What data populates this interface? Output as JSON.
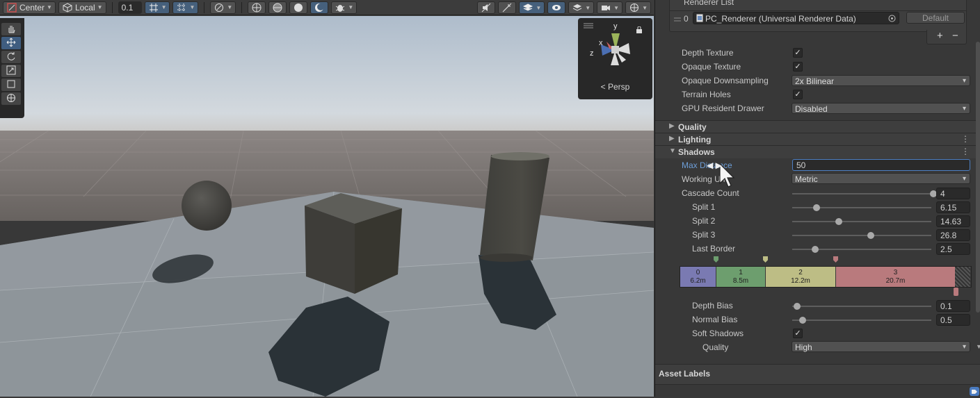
{
  "toolbar": {
    "pivot_mode": "Center",
    "pivot_rotation": "Local",
    "snap_increment": "0.1"
  },
  "scene": {
    "camera_projection": "Persp",
    "gizmo_axes": [
      "y",
      "x",
      "z"
    ],
    "tools": [
      "hand-tool",
      "move-tool",
      "rotate-tool",
      "scale-tool",
      "rect-tool",
      "transform-tool"
    ]
  },
  "inspector": {
    "renderer_list": {
      "title": "Renderer List",
      "items": [
        {
          "index": "0",
          "name": "PC_Renderer (Universal Renderer Data)",
          "default_button": "Default"
        }
      ],
      "add": "+",
      "remove": "−"
    },
    "rendering": {
      "depth_texture": {
        "label": "Depth Texture",
        "checked": true
      },
      "opaque_texture": {
        "label": "Opaque Texture",
        "checked": true
      },
      "opaque_downsampling": {
        "label": "Opaque Downsampling",
        "value": "2x Bilinear"
      },
      "terrain_holes": {
        "label": "Terrain Holes",
        "checked": true
      },
      "gpu_resident_drawer": {
        "label": "GPU Resident Drawer",
        "value": "Disabled"
      }
    },
    "sections": {
      "quality": "Quality",
      "lighting": "Lighting",
      "shadows": "Shadows"
    },
    "shadows": {
      "max_distance": {
        "label": "Max Distance",
        "value": "50"
      },
      "working_unit": {
        "label": "Working Unit",
        "value": "Metric"
      },
      "cascade_count": {
        "label": "Cascade Count",
        "value": "4",
        "slider": 0.98
      },
      "split1": {
        "label": "Split 1",
        "value": "6.15",
        "slider": 0.14
      },
      "split2": {
        "label": "Split 2",
        "value": "14.63",
        "slider": 0.3
      },
      "split3": {
        "label": "Split 3",
        "value": "26.8",
        "slider": 0.53
      },
      "last_border": {
        "label": "Last Border",
        "value": "2.5",
        "slider": 0.13
      },
      "cascades": [
        {
          "index": "0",
          "distance": "6.2m",
          "color": "#7a7ab2",
          "share": 12.4
        },
        {
          "index": "1",
          "distance": "8.5m",
          "color": "#6d9e6e",
          "share": 17.0
        },
        {
          "index": "2",
          "distance": "12.2m",
          "color": "#bdbd85",
          "share": 24.3
        },
        {
          "index": "3",
          "distance": "20.7m",
          "color": "#b97a7d",
          "share": 41.3
        }
      ],
      "depth_bias": {
        "label": "Depth Bias",
        "value": "0.1",
        "slider": 0.0
      },
      "normal_bias": {
        "label": "Normal Bias",
        "value": "0.5",
        "slider": 0.04
      },
      "soft_shadows": {
        "label": "Soft Shadows",
        "checked": true
      },
      "quality": {
        "label": "Quality",
        "value": "High"
      }
    },
    "asset_labels": "Asset Labels"
  },
  "colors": {
    "accent": "#4d7fc4",
    "panel": "#383838",
    "header": "#3e3e3e"
  }
}
